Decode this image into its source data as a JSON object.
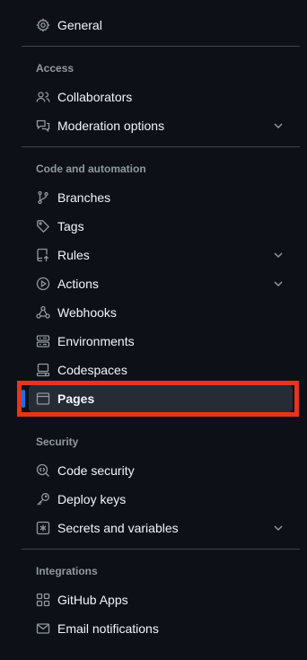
{
  "sidebar": {
    "general": {
      "label": "General",
      "icon": "gear-icon"
    },
    "access": {
      "heading": "Access",
      "items": [
        {
          "label": "Collaborators",
          "icon": "people-icon"
        },
        {
          "label": "Moderation options",
          "icon": "comment-discussion-icon",
          "expandable": true
        }
      ]
    },
    "code_automation": {
      "heading": "Code and automation",
      "items": [
        {
          "label": "Branches",
          "icon": "git-branch-icon"
        },
        {
          "label": "Tags",
          "icon": "tag-icon"
        },
        {
          "label": "Rules",
          "icon": "repo-push-icon",
          "expandable": true
        },
        {
          "label": "Actions",
          "icon": "play-icon",
          "expandable": true
        },
        {
          "label": "Webhooks",
          "icon": "webhook-icon"
        },
        {
          "label": "Environments",
          "icon": "server-icon"
        },
        {
          "label": "Codespaces",
          "icon": "codespaces-icon"
        },
        {
          "label": "Pages",
          "icon": "browser-icon",
          "active": true
        }
      ]
    },
    "security": {
      "heading": "Security",
      "items": [
        {
          "label": "Code security",
          "icon": "codescan-icon"
        },
        {
          "label": "Deploy keys",
          "icon": "key-icon"
        },
        {
          "label": "Secrets and variables",
          "icon": "key-asterisk-icon",
          "expandable": true
        }
      ]
    },
    "integrations": {
      "heading": "Integrations",
      "items": [
        {
          "label": "GitHub Apps",
          "icon": "apps-icon"
        },
        {
          "label": "Email notifications",
          "icon": "mail-icon"
        }
      ]
    }
  },
  "annotation": {
    "color": "#e8341c"
  },
  "colors": {
    "background": "#0d1117",
    "text": "#f0f6fc",
    "muted": "#9198a1",
    "active_bg": "#262c36",
    "active_marker": "#1f6feb"
  }
}
